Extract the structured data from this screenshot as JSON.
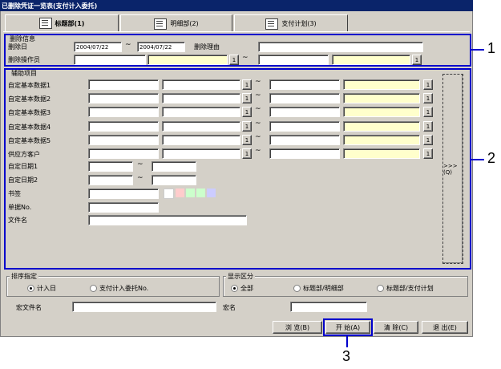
{
  "window": {
    "title": "已删除凭证一览表(支付计入委托)"
  },
  "tabs": [
    {
      "label": "标题部(1)",
      "icon": "book-icon"
    },
    {
      "label": "明细部(2)",
      "icon": "document-icon"
    },
    {
      "label": "支付计划(3)",
      "icon": "schedule-icon"
    }
  ],
  "delete_info": {
    "legend": "删除信息",
    "date_label": "删除日",
    "date_from": "2004/07/22",
    "date_to": "2004/07/22",
    "reason_label": "删除理由",
    "operator_label": "删除操作员"
  },
  "aux": {
    "legend": "辅助项目",
    "rows": [
      "自定基本数据1",
      "自定基本数据2",
      "自定基本数据3",
      "自定基本数据4",
      "自定基本数据5",
      "供应方客户"
    ],
    "date1_label": "自定日期1",
    "date2_label": "自定日期2",
    "bookmark_label": "书签",
    "slip_no_label": "单据No.",
    "filename_label": "文件名",
    "expand_button": ">>>(Q)",
    "bookmark_colors": [
      "#ffffff",
      "#ffcccc",
      "#ccffcc",
      "#ccffcc",
      "#ccccff"
    ]
  },
  "sort": {
    "legend": "排序指定",
    "options": [
      "计入日",
      "支付计入委托No."
    ],
    "selected": 0
  },
  "display": {
    "legend": "显示区分",
    "options": [
      "全部",
      "标题部/明细部",
      "标题部/支付计划"
    ],
    "selected": 0
  },
  "macro": {
    "file_label": "宏文件名",
    "name_label": "宏名"
  },
  "footer": {
    "preview": "浏 览(B)",
    "start": "开 始(A)",
    "clear": "清 除(C)",
    "exit": "退 出(E)"
  },
  "lookup_button": "1",
  "tilde": "~",
  "callouts": [
    "1",
    "2",
    "3"
  ]
}
